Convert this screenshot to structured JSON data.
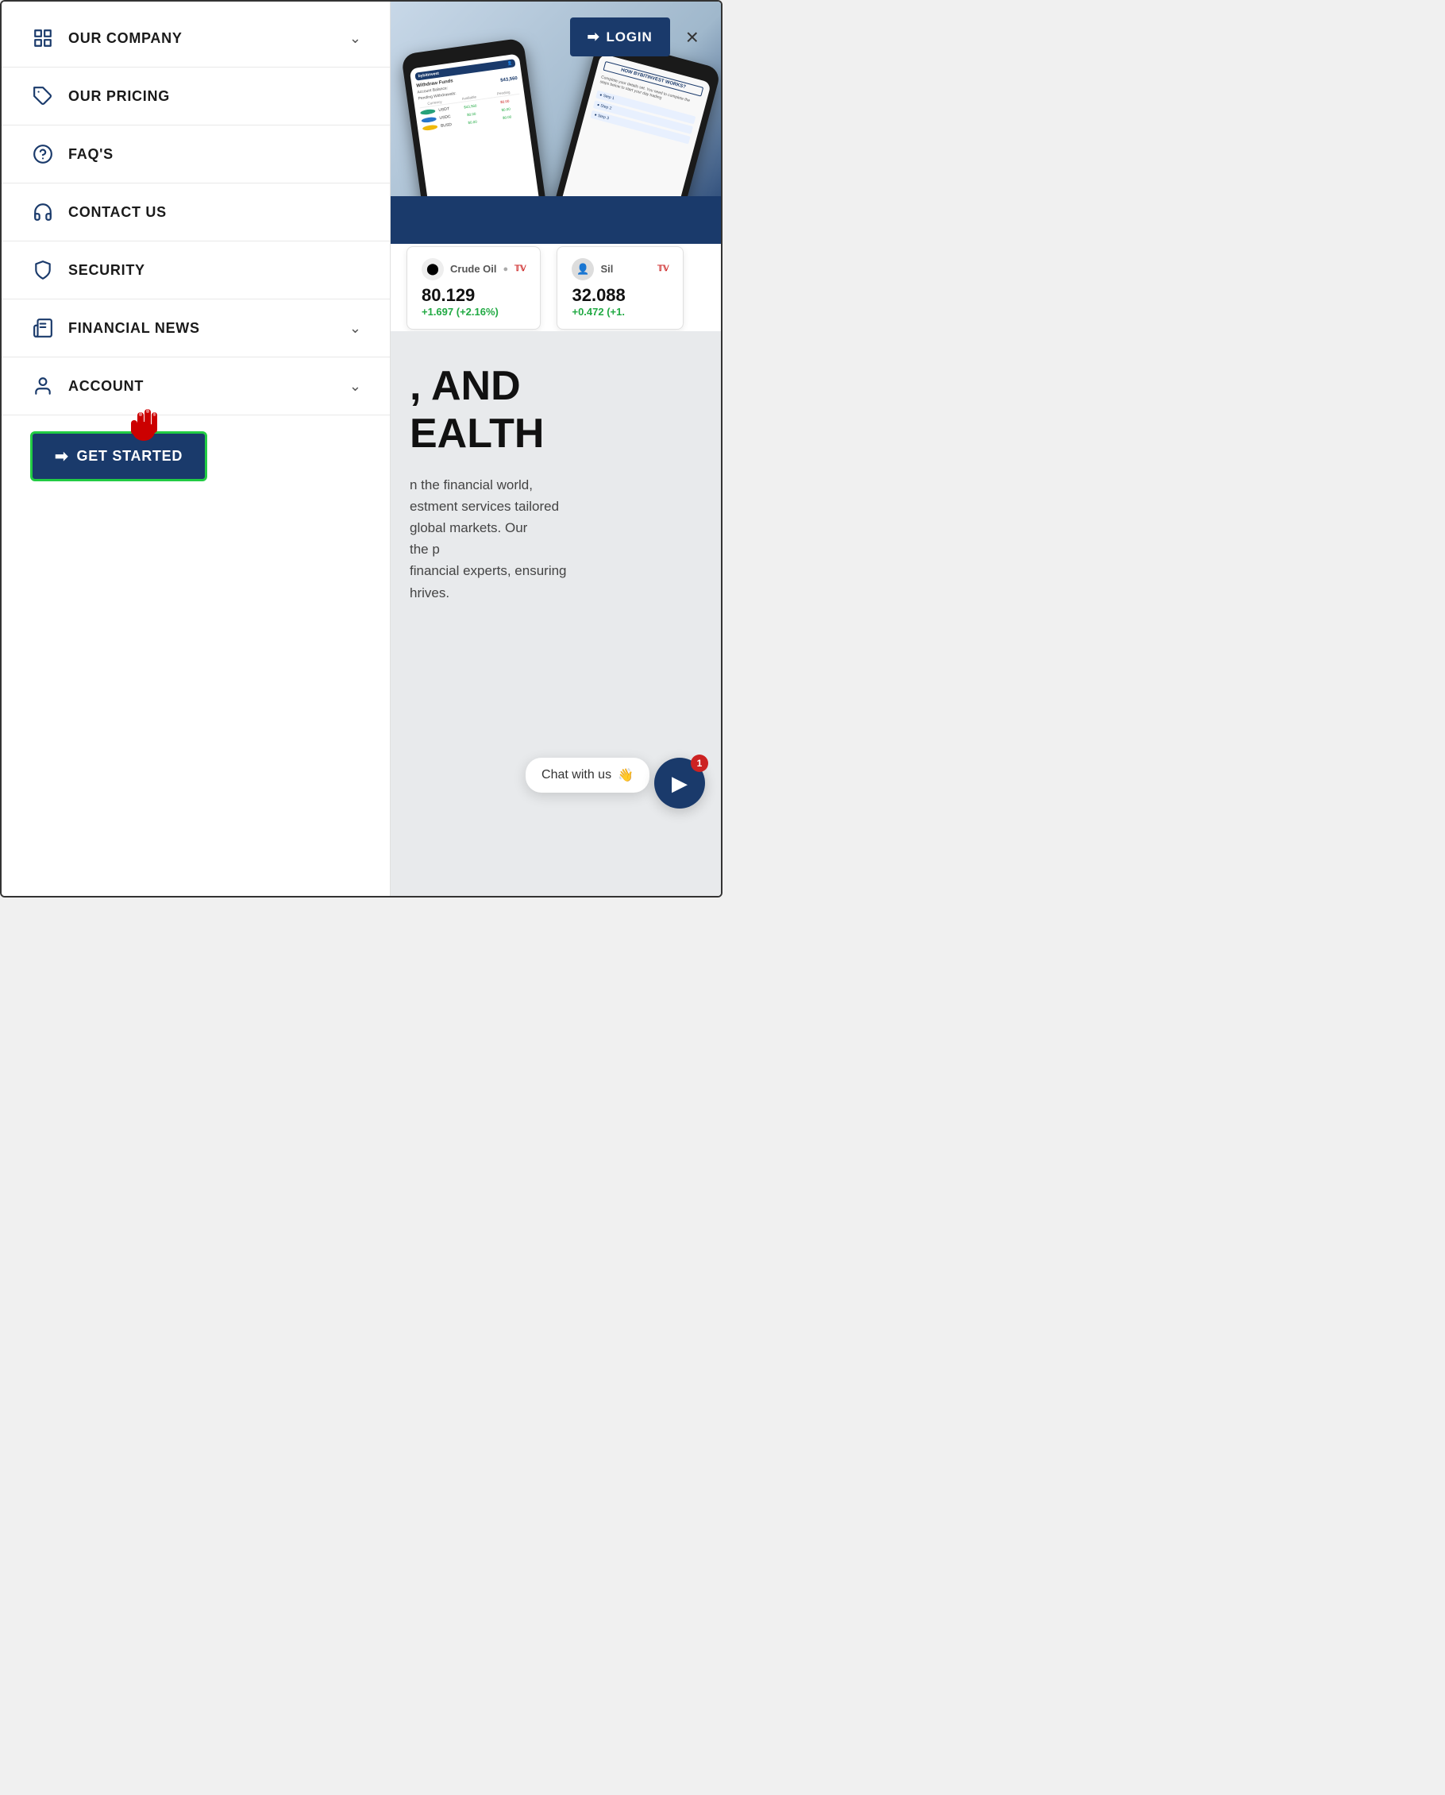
{
  "header": {
    "login_label": "LOGIN",
    "close_label": "×"
  },
  "nav": {
    "items": [
      {
        "id": "our-company",
        "label": "OUR COMPANY",
        "icon": "building",
        "has_chevron": true
      },
      {
        "id": "our-pricing",
        "label": "OUR PRICING",
        "icon": "tag",
        "has_chevron": false
      },
      {
        "id": "faqs",
        "label": "FAQ'S",
        "icon": "question",
        "has_chevron": false
      },
      {
        "id": "contact-us",
        "label": "CONTACT US",
        "icon": "headset",
        "has_chevron": false
      },
      {
        "id": "security",
        "label": "SECURITY",
        "icon": "shield",
        "has_chevron": false
      },
      {
        "id": "financial-news",
        "label": "FINANCIAL NEWS",
        "icon": "news",
        "has_chevron": true
      },
      {
        "id": "account",
        "label": "ACCOUNT",
        "icon": "user",
        "has_chevron": true
      }
    ],
    "cta_label": "GET STARTED"
  },
  "phone": {
    "withdraw_title": "Withdraw Funds",
    "balance_label": "Account Balance:",
    "balance_amount": "$43,560",
    "pending_label": "Pending Withdrawals:",
    "table_headers": [
      "Currency",
      "Available",
      "Pending"
    ],
    "rows": [
      {
        "coin": "USDT",
        "available": "$43,560",
        "pending": "$0.00",
        "color": "#26a17b"
      },
      {
        "coin": "USDC",
        "available": "$0.00",
        "pending": "$0.00",
        "color": "#2775ca"
      },
      {
        "coin": "BUSD",
        "available": "$0.00",
        "pending": "$0.00",
        "color": "#f0b90b"
      }
    ],
    "back_screen_label": "HOW BYBITINVEST WORKS?"
  },
  "tickers": [
    {
      "name": "Crude Oil",
      "icon": "⬤",
      "icon_color": "#111",
      "price": "80.129",
      "change": "+1.697 (+2.16%)",
      "logo": "TW"
    },
    {
      "name": "Sil",
      "icon": "👤",
      "icon_color": "#888",
      "price": "32.088",
      "change": "+0.472 (+1.",
      "logo": "TW"
    }
  ],
  "hero": {
    "title_line1": ", AND",
    "title_line2": "EALTH",
    "body_line1": "n the financial world,",
    "body_line2": "estment services tailored",
    "body_line3": "global markets. Our",
    "body_line4": "the p",
    "body_line5": "financial experts, ensuring",
    "body_line6": "hrives."
  },
  "chat": {
    "label": "Chat with us",
    "emoji": "👋",
    "badge": "1"
  }
}
